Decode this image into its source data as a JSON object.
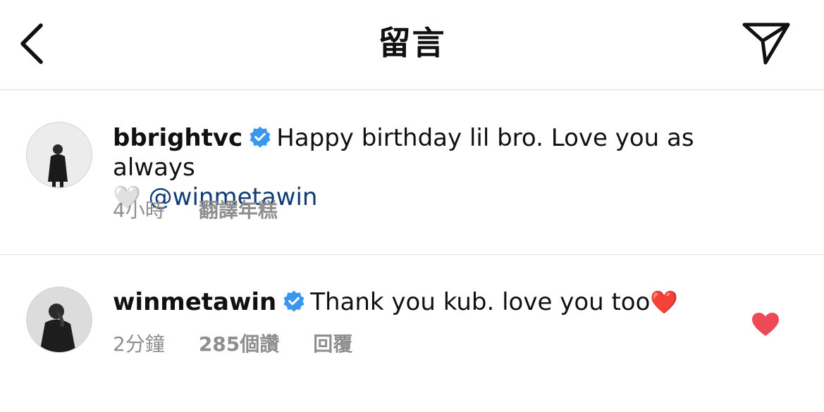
{
  "header": {
    "title": "留言"
  },
  "comments": [
    {
      "username": "bbrightvc",
      "text": "Happy birthday lil bro. Love you as always",
      "emoji": "🤍",
      "mention": "@winmetawin",
      "time": "4小時",
      "action": "翻譯年糕"
    },
    {
      "username": "winmetawin",
      "text": "Thank you kub. love you too",
      "emoji": "❤️",
      "time": "2分鐘",
      "likes": "285個讚",
      "action": "回覆",
      "liked": true
    }
  ],
  "colors": {
    "verified": "#3897f0",
    "like": "#ed4956",
    "mention": "#0f3c77",
    "meta": "#8e8e8e"
  }
}
